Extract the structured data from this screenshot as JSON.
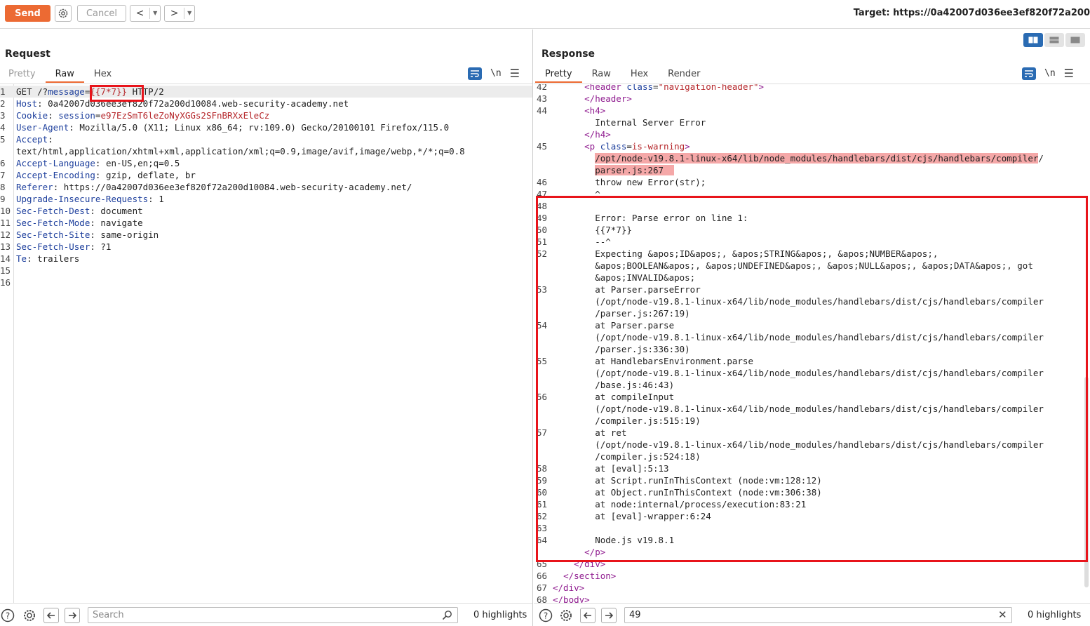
{
  "toolbar": {
    "send_label": "Send",
    "cancel_label": "Cancel",
    "back_glyph": "<",
    "forward_glyph": ">",
    "dropdown_glyph": "▼",
    "target_text": "Target: https://0a42007d036ee3ef820f72a200"
  },
  "request": {
    "title": "Request",
    "tabs": [
      "Pretty",
      "Raw",
      "Hex"
    ],
    "active_tab": "Raw",
    "wrap_glyph": "\\n",
    "lines": [
      {
        "n": "1",
        "parts": [
          {
            "t": "GET /?",
            "c": ""
          },
          {
            "t": "message",
            "c": "param"
          },
          {
            "t": "=",
            "c": ""
          },
          {
            "t": "{{7*7}}",
            "c": "paramval"
          },
          {
            "t": " HTTP/2",
            "c": ""
          }
        ]
      },
      {
        "n": "2",
        "parts": [
          {
            "t": "Host",
            "c": "hdr"
          },
          {
            "t": ": 0a42007d036ee3ef820f72a200d10084.web-security-academy.net",
            "c": ""
          }
        ]
      },
      {
        "n": "3",
        "parts": [
          {
            "t": "Cookie",
            "c": "hdr"
          },
          {
            "t": ": ",
            "c": ""
          },
          {
            "t": "session",
            "c": "hdr"
          },
          {
            "t": "=",
            "c": ""
          },
          {
            "t": "e97EzSmT6leZoNyXGGs2SFnBRXxEleCz",
            "c": "cookie"
          }
        ]
      },
      {
        "n": "4",
        "parts": [
          {
            "t": "User-Agent",
            "c": "hdr"
          },
          {
            "t": ": Mozilla/5.0 (X11; Linux x86_64; rv:109.0) Gecko/20100101 Firefox/115.0",
            "c": ""
          }
        ]
      },
      {
        "n": "5",
        "parts": [
          {
            "t": "Accept",
            "c": "hdr"
          },
          {
            "t": ":",
            "c": ""
          }
        ]
      },
      {
        "n": "",
        "parts": [
          {
            "t": "text/html,application/xhtml+xml,application/xml;q=0.9,image/avif,image/webp,*/*;q=0.8",
            "c": ""
          }
        ]
      },
      {
        "n": "6",
        "parts": [
          {
            "t": "Accept-Language",
            "c": "hdr"
          },
          {
            "t": ": en-US,en;q=0.5",
            "c": ""
          }
        ]
      },
      {
        "n": "7",
        "parts": [
          {
            "t": "Accept-Encoding",
            "c": "hdr"
          },
          {
            "t": ": gzip, deflate, br",
            "c": ""
          }
        ]
      },
      {
        "n": "8",
        "parts": [
          {
            "t": "Referer",
            "c": "hdr"
          },
          {
            "t": ": https://0a42007d036ee3ef820f72a200d10084.web-security-academy.net/",
            "c": ""
          }
        ]
      },
      {
        "n": "9",
        "parts": [
          {
            "t": "Upgrade-Insecure-Requests",
            "c": "hdr"
          },
          {
            "t": ": 1",
            "c": ""
          }
        ]
      },
      {
        "n": "10",
        "parts": [
          {
            "t": "Sec-Fetch-Dest",
            "c": "hdr"
          },
          {
            "t": ": document",
            "c": ""
          }
        ]
      },
      {
        "n": "11",
        "parts": [
          {
            "t": "Sec-Fetch-Mode",
            "c": "hdr"
          },
          {
            "t": ": navigate",
            "c": ""
          }
        ]
      },
      {
        "n": "12",
        "parts": [
          {
            "t": "Sec-Fetch-Site",
            "c": "hdr"
          },
          {
            "t": ": same-origin",
            "c": ""
          }
        ]
      },
      {
        "n": "13",
        "parts": [
          {
            "t": "Sec-Fetch-User",
            "c": "hdr"
          },
          {
            "t": ": ?1",
            "c": ""
          }
        ]
      },
      {
        "n": "14",
        "parts": [
          {
            "t": "Te",
            "c": "hdr"
          },
          {
            "t": ": trailers",
            "c": ""
          }
        ]
      },
      {
        "n": "15",
        "parts": []
      },
      {
        "n": "16",
        "parts": []
      }
    ],
    "search_placeholder": "Search",
    "highlights": "0 highlights"
  },
  "response": {
    "title": "Response",
    "tabs": [
      "Pretty",
      "Raw",
      "Hex",
      "Render"
    ],
    "active_tab": "Pretty",
    "wrap_glyph": "\\n",
    "lines": [
      {
        "n": "42",
        "indent": "      ",
        "parts": [
          {
            "t": "<header ",
            "c": "tag"
          },
          {
            "t": "class",
            "c": "attr"
          },
          {
            "t": "=",
            "c": ""
          },
          {
            "t": "\"navigation-header\"",
            "c": "attrval"
          },
          {
            "t": ">",
            "c": "tag"
          }
        ]
      },
      {
        "n": "43",
        "indent": "      ",
        "parts": [
          {
            "t": "</header>",
            "c": "tag"
          }
        ]
      },
      {
        "n": "44",
        "indent": "      ",
        "parts": [
          {
            "t": "<h4>",
            "c": "tag"
          }
        ]
      },
      {
        "n": "",
        "indent": "        ",
        "parts": [
          {
            "t": "Internal Server Error",
            "c": ""
          }
        ]
      },
      {
        "n": "",
        "indent": "      ",
        "parts": [
          {
            "t": "</h4>",
            "c": "tag"
          }
        ]
      },
      {
        "n": "45",
        "indent": "      ",
        "parts": [
          {
            "t": "<p ",
            "c": "tag"
          },
          {
            "t": "class",
            "c": "attr"
          },
          {
            "t": "=",
            "c": ""
          },
          {
            "t": "is-warning",
            "c": "attrval"
          },
          {
            "t": ">",
            "c": "tag"
          }
        ]
      },
      {
        "n": "",
        "indent": "        ",
        "parts": [
          {
            "t": "/opt/node-v19.8.1-linux-x64/lib/node_modules/handlebars/dist/cjs/handlebars/compiler",
            "c": "pink"
          },
          {
            "t": "/",
            "c": ""
          }
        ]
      },
      {
        "n": "",
        "indent": "        ",
        "parts": [
          {
            "t": "parser.js:267  ",
            "c": "pink"
          }
        ]
      },
      {
        "n": "46",
        "indent": "        ",
        "parts": [
          {
            "t": "throw new Error(str);",
            "c": ""
          }
        ]
      },
      {
        "n": "47",
        "indent": "        ",
        "parts": [
          {
            "t": "^",
            "c": ""
          }
        ]
      },
      {
        "n": "48",
        "indent": "",
        "parts": []
      },
      {
        "n": "49",
        "indent": "        ",
        "parts": [
          {
            "t": "Error: Parse error on line 1:",
            "c": ""
          }
        ]
      },
      {
        "n": "50",
        "indent": "        ",
        "parts": [
          {
            "t": "{{7*7}}",
            "c": ""
          }
        ]
      },
      {
        "n": "51",
        "indent": "        ",
        "parts": [
          {
            "t": "--^",
            "c": ""
          }
        ]
      },
      {
        "n": "52",
        "indent": "        ",
        "parts": [
          {
            "t": "Expecting &apos;ID&apos;, &apos;STRING&apos;, &apos;NUMBER&apos;,",
            "c": ""
          }
        ]
      },
      {
        "n": "",
        "indent": "        ",
        "parts": [
          {
            "t": "&apos;BOOLEAN&apos;, &apos;UNDEFINED&apos;, &apos;NULL&apos;, &apos;DATA&apos;, got",
            "c": ""
          }
        ]
      },
      {
        "n": "",
        "indent": "        ",
        "parts": [
          {
            "t": "&apos;INVALID&apos;",
            "c": ""
          }
        ]
      },
      {
        "n": "53",
        "indent": "        ",
        "parts": [
          {
            "t": "at Parser.parseError",
            "c": ""
          }
        ]
      },
      {
        "n": "",
        "indent": "        ",
        "parts": [
          {
            "t": "(/opt/node-v19.8.1-linux-x64/lib/node_modules/handlebars/dist/cjs/handlebars/compiler",
            "c": ""
          }
        ]
      },
      {
        "n": "",
        "indent": "        ",
        "parts": [
          {
            "t": "/parser.js:267:19)",
            "c": ""
          }
        ]
      },
      {
        "n": "54",
        "indent": "        ",
        "parts": [
          {
            "t": "at Parser.parse",
            "c": ""
          }
        ]
      },
      {
        "n": "",
        "indent": "        ",
        "parts": [
          {
            "t": "(/opt/node-v19.8.1-linux-x64/lib/node_modules/handlebars/dist/cjs/handlebars/compiler",
            "c": ""
          }
        ]
      },
      {
        "n": "",
        "indent": "        ",
        "parts": [
          {
            "t": "/parser.js:336:30)",
            "c": ""
          }
        ]
      },
      {
        "n": "55",
        "indent": "        ",
        "parts": [
          {
            "t": "at HandlebarsEnvironment.parse",
            "c": ""
          }
        ]
      },
      {
        "n": "",
        "indent": "        ",
        "parts": [
          {
            "t": "(/opt/node-v19.8.1-linux-x64/lib/node_modules/handlebars/dist/cjs/handlebars/compiler",
            "c": ""
          }
        ]
      },
      {
        "n": "",
        "indent": "        ",
        "parts": [
          {
            "t": "/base.js:46:43)",
            "c": ""
          }
        ]
      },
      {
        "n": "56",
        "indent": "        ",
        "parts": [
          {
            "t": "at compileInput",
            "c": ""
          }
        ]
      },
      {
        "n": "",
        "indent": "        ",
        "parts": [
          {
            "t": "(/opt/node-v19.8.1-linux-x64/lib/node_modules/handlebars/dist/cjs/handlebars/compiler",
            "c": ""
          }
        ]
      },
      {
        "n": "",
        "indent": "        ",
        "parts": [
          {
            "t": "/compiler.js:515:19)",
            "c": ""
          }
        ]
      },
      {
        "n": "57",
        "indent": "        ",
        "parts": [
          {
            "t": "at ret",
            "c": ""
          }
        ]
      },
      {
        "n": "",
        "indent": "        ",
        "parts": [
          {
            "t": "(/opt/node-v19.8.1-linux-x64/lib/node_modules/handlebars/dist/cjs/handlebars/compiler",
            "c": ""
          }
        ]
      },
      {
        "n": "",
        "indent": "        ",
        "parts": [
          {
            "t": "/compiler.js:524:18)",
            "c": ""
          }
        ]
      },
      {
        "n": "58",
        "indent": "        ",
        "parts": [
          {
            "t": "at [eval]:5:13",
            "c": ""
          }
        ]
      },
      {
        "n": "59",
        "indent": "        ",
        "parts": [
          {
            "t": "at Script.runInThisContext (node:vm:128:12)",
            "c": ""
          }
        ]
      },
      {
        "n": "60",
        "indent": "        ",
        "parts": [
          {
            "t": "at Object.runInThisContext (node:vm:306:38)",
            "c": ""
          }
        ]
      },
      {
        "n": "61",
        "indent": "        ",
        "parts": [
          {
            "t": "at node:internal/process/execution:83:21",
            "c": ""
          }
        ]
      },
      {
        "n": "62",
        "indent": "        ",
        "parts": [
          {
            "t": "at [eval]-wrapper:6:24",
            "c": ""
          }
        ]
      },
      {
        "n": "63",
        "indent": "",
        "parts": []
      },
      {
        "n": "64",
        "indent": "        ",
        "parts": [
          {
            "t": "Node.js v19.8.1",
            "c": ""
          }
        ]
      },
      {
        "n": "",
        "indent": "      ",
        "parts": [
          {
            "t": "</p>",
            "c": "tag"
          }
        ]
      },
      {
        "n": "65",
        "indent": "    ",
        "parts": [
          {
            "t": "</div>",
            "c": "tag"
          }
        ]
      },
      {
        "n": "66",
        "indent": "  ",
        "parts": [
          {
            "t": "</section>",
            "c": "tag"
          }
        ]
      },
      {
        "n": "67",
        "indent": "",
        "parts": [
          {
            "t": "</div>",
            "c": "tag"
          }
        ]
      },
      {
        "n": "68",
        "indent": "",
        "parts": [
          {
            "t": "</body>",
            "c": "tag"
          }
        ]
      }
    ],
    "search_value": "49",
    "highlights": "0 highlights"
  },
  "colors": {
    "accent": "#ec6a33",
    "annotation": "#e8141b",
    "header_name": "#1c3e9c",
    "cookie_value": "#b5262a",
    "html_tag": "#8f1b8f"
  }
}
